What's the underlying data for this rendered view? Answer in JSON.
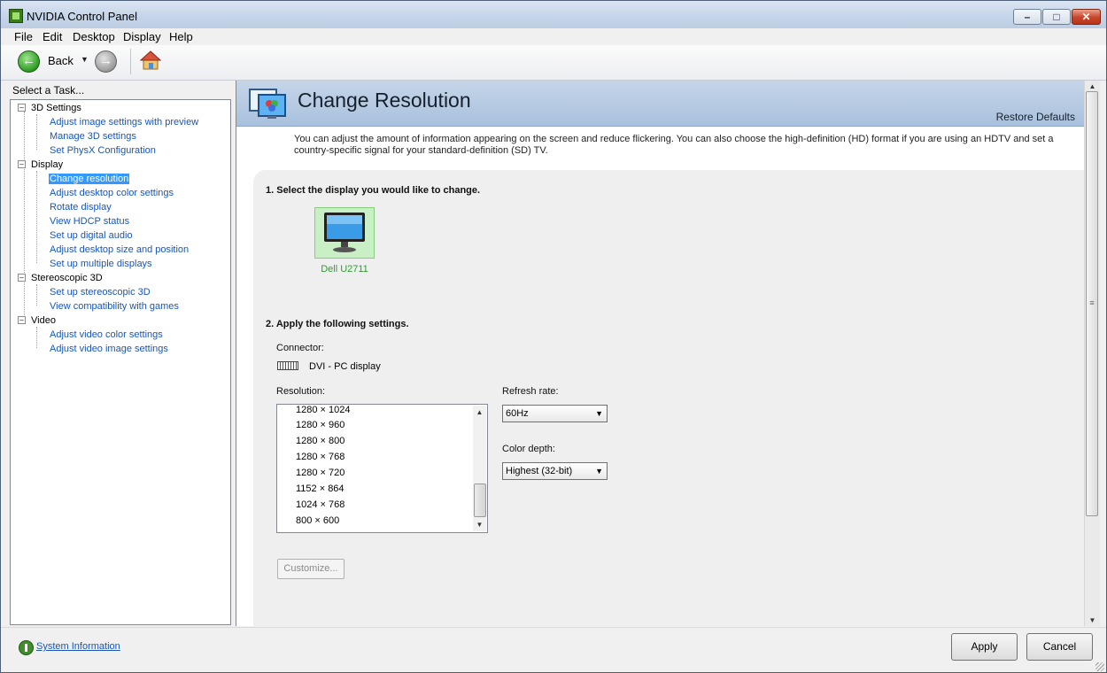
{
  "window": {
    "title": "NVIDIA Control Panel",
    "minimize": "–",
    "maximize": "□",
    "close": "✕"
  },
  "menu": [
    "File",
    "Edit",
    "Desktop",
    "Display",
    "Help"
  ],
  "toolbar": {
    "back_label": "Back",
    "back_glyph": "←",
    "forward_glyph": "→",
    "dropdown_glyph": "▼"
  },
  "sidebar": {
    "title": "Select a Task...",
    "categories": [
      {
        "label": "3D Settings",
        "expander": "–",
        "items": [
          "Adjust image settings with preview",
          "Manage 3D settings",
          "Set PhysX Configuration"
        ]
      },
      {
        "label": "Display",
        "expander": "–",
        "items": [
          "Change resolution",
          "Adjust desktop color settings",
          "Rotate display",
          "View HDCP status",
          "Set up digital audio",
          "Adjust desktop size and position",
          "Set up multiple displays"
        ]
      },
      {
        "label": "Stereoscopic 3D",
        "expander": "–",
        "items": [
          "Set up stereoscopic 3D",
          "View compatibility with games"
        ]
      },
      {
        "label": "Video",
        "expander": "–",
        "items": [
          "Adjust video color settings",
          "Adjust video image settings"
        ]
      }
    ],
    "selected": "Change resolution"
  },
  "page": {
    "title": "Change Resolution",
    "restore_defaults": "Restore Defaults",
    "description": "You can adjust the amount of information appearing on the screen and reduce flickering. You can also choose the high-definition (HD) format if you are using an HDTV and set a country-specific signal for your standard-definition (SD) TV.",
    "step1": "1. Select the display you would like to change.",
    "display_name": "Dell U2711",
    "step2": "2. Apply the following settings.",
    "connector_label": "Connector:",
    "connector_value": "DVI - PC display",
    "resolution_label": "Resolution:",
    "resolutions": [
      "1280 × 1024",
      "1280 × 960",
      "1280 × 800",
      "1280 × 768",
      "1280 × 720",
      "1152 × 864",
      "1024 × 768",
      "800 × 600"
    ],
    "refresh_label": "Refresh rate:",
    "refresh_value": "60Hz",
    "color_depth_label": "Color depth:",
    "color_depth_value": "Highest (32-bit)",
    "customize": "Customize..."
  },
  "footer": {
    "system_info": "System Information",
    "apply": "Apply",
    "cancel": "Cancel"
  },
  "colors": {
    "link": "#1a56b6",
    "selected": "#3399ff",
    "banner": "#a9c1dd",
    "display_name": "#2e9b2e"
  },
  "icons": {
    "app": "nvidia-icon",
    "back": "back-arrow-icon",
    "forward": "forward-arrow-icon",
    "home": "home-icon",
    "banner": "display-settings-icon",
    "monitor": "monitor-icon",
    "connector": "dvi-connector-icon",
    "sysinfo": "nvidia-info-icon"
  }
}
